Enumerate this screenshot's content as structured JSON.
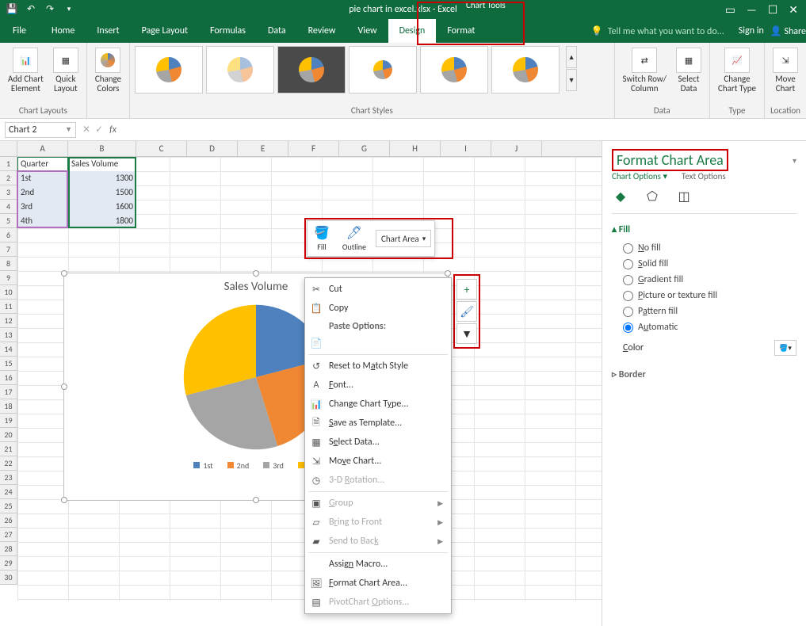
{
  "chart_data": {
    "type": "pie",
    "title": "Sales Volume",
    "categories": [
      "1st",
      "2nd",
      "3rd",
      "4th"
    ],
    "values": [
      1300,
      1500,
      1600,
      1800
    ],
    "colors": [
      "#4e81bd",
      "#ef8733",
      "#a5a5a5",
      "#ffc000"
    ]
  },
  "titlebar": {
    "title": "pie chart in excel.xlsx - Excel",
    "context_title": "Chart Tools"
  },
  "tabs": {
    "file": "File",
    "home": "Home",
    "insert": "Insert",
    "page_layout": "Page Layout",
    "formulas": "Formulas",
    "data": "Data",
    "review": "Review",
    "view": "View",
    "design": "Design",
    "format": "Format",
    "tellme": "Tell me what you want to do...",
    "signin": "Sign in",
    "share": "Share"
  },
  "ribbon": {
    "chart_layouts": {
      "add_element": "Add Chart\nElement",
      "quick_layout": "Quick\nLayout",
      "group": "Chart Layouts"
    },
    "change_colors": "Change\nColors",
    "chart_styles_group": "Chart Styles",
    "data": {
      "switch": "Switch Row/\nColumn",
      "select": "Select\nData",
      "group": "Data"
    },
    "type": {
      "change": "Change\nChart Type",
      "group": "Type"
    },
    "location": {
      "move": "Move\nChart",
      "group": "Location"
    }
  },
  "namebox": "Chart 2",
  "grid": {
    "cols": [
      "A",
      "B",
      "C",
      "D",
      "E",
      "F",
      "G",
      "H",
      "I",
      "J"
    ],
    "rows": 30,
    "a1": "Quarter",
    "b1": "Sales Volume",
    "col_a": [
      "1st",
      "2nd",
      "3rd",
      "4th"
    ],
    "col_b": [
      "1300",
      "1500",
      "1600",
      "1800"
    ]
  },
  "mini_toolbar": {
    "fill": "Fill",
    "outline": "Outline",
    "selector": "Chart Area"
  },
  "context_menu": {
    "cut": "Cut",
    "copy": "Copy",
    "paste_options": "Paste Options:",
    "reset": "Reset to Match Style",
    "font": "Font...",
    "change_chart_type": "Change Chart Type...",
    "save_template": "Save as Template...",
    "select_data": "Select Data...",
    "move_chart": "Move Chart...",
    "rotation3d": "3-D Rotation...",
    "group": "Group",
    "bring_front": "Bring to Front",
    "send_back": "Send to Back",
    "assign_macro": "Assign Macro...",
    "format_area": "Format Chart Area...",
    "pivot_options": "PivotChart Options..."
  },
  "format_pane": {
    "title": "Format Chart Area",
    "tab_chart_options": "Chart Options",
    "tab_text_options": "Text Options",
    "fill_hdr": "Fill",
    "no_fill": "No fill",
    "solid_fill": "Solid fill",
    "gradient_fill": "Gradient fill",
    "picture_fill": "Picture or texture fill",
    "pattern_fill": "Pattern fill",
    "automatic": "Automatic",
    "color": "Color",
    "border_hdr": "Border"
  }
}
